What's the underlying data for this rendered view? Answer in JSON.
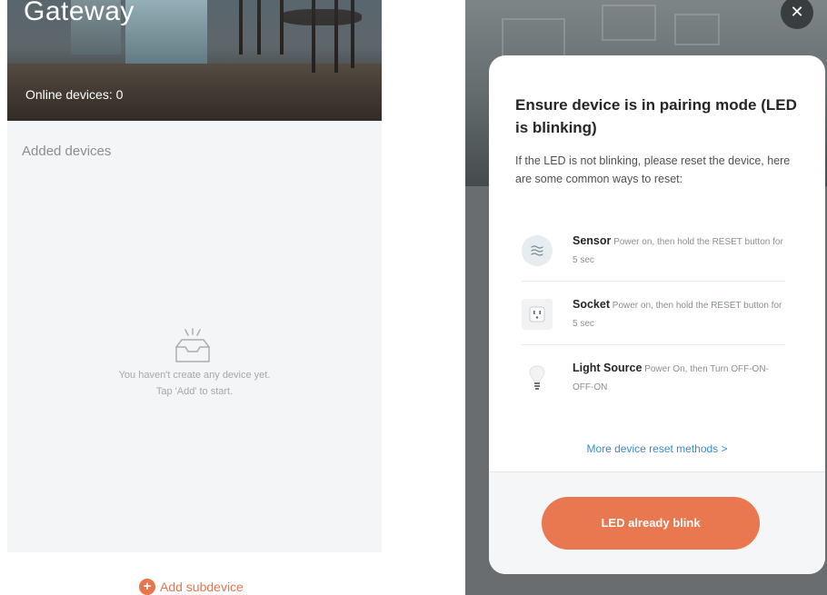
{
  "left": {
    "title": "Gateway",
    "online_devices": "Online devices: 0",
    "added_devices_label": "Added devices",
    "empty_line1": "You haven't create any device yet.",
    "empty_line2": "Tap 'Add' to start.",
    "add_subdevice": "Add subdevice",
    "empty_icon": "empty-tray-icon",
    "plus_icon": "plus-circle-icon"
  },
  "modal": {
    "close_icon": "close-icon",
    "title": "Ensure device is in pairing mode (LED is blinking)",
    "description": "If the LED is not blinking, please reset the device, here are some common ways to reset:",
    "methods": [
      {
        "name": "Sensor",
        "instruction": "Power on, then hold the RESET button for 5 sec",
        "icon": "sensor-icon"
      },
      {
        "name": "Socket",
        "instruction": "Power on, then hold the RESET button for 5 sec",
        "icon": "socket-icon"
      },
      {
        "name": "Light Source",
        "instruction": "Power On, then Turn OFF-ON-OFF-ON",
        "icon": "bulb-icon"
      }
    ],
    "more_link": "More device reset methods >",
    "confirm_button": "LED already blink"
  },
  "colors": {
    "accent": "#e9754c",
    "link": "#3a8bd0"
  }
}
